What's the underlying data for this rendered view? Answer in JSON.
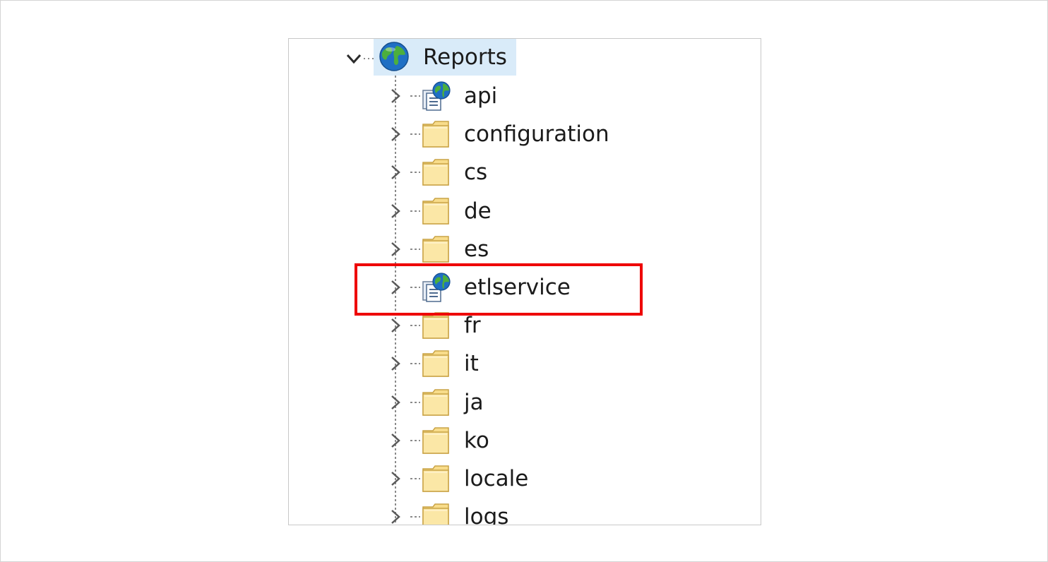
{
  "tree": {
    "root": {
      "label": "Reports",
      "icon": "globe-icon",
      "expanded": true,
      "selected": true
    },
    "children": [
      {
        "label": "api",
        "icon": "web-application-icon",
        "highlighted": false
      },
      {
        "label": "configuration",
        "icon": "folder-icon",
        "highlighted": false
      },
      {
        "label": "cs",
        "icon": "folder-icon",
        "highlighted": false
      },
      {
        "label": "de",
        "icon": "folder-icon",
        "highlighted": false
      },
      {
        "label": "es",
        "icon": "folder-icon",
        "highlighted": false
      },
      {
        "label": "etlservice",
        "icon": "web-application-icon",
        "highlighted": true
      },
      {
        "label": "fr",
        "icon": "folder-icon",
        "highlighted": false
      },
      {
        "label": "it",
        "icon": "folder-icon",
        "highlighted": false
      },
      {
        "label": "ja",
        "icon": "folder-icon",
        "highlighted": false
      },
      {
        "label": "ko",
        "icon": "folder-icon",
        "highlighted": false
      },
      {
        "label": "locale",
        "icon": "folder-icon",
        "highlighted": false
      },
      {
        "label": "logs",
        "icon": "folder-icon",
        "highlighted": false
      }
    ]
  },
  "colors": {
    "selection": "#d9ebf9",
    "annotation": "#ee0000",
    "folder_fill": "#f8dc8a",
    "globe_blue": "#1f6fc4",
    "globe_green": "#4caf3d"
  }
}
